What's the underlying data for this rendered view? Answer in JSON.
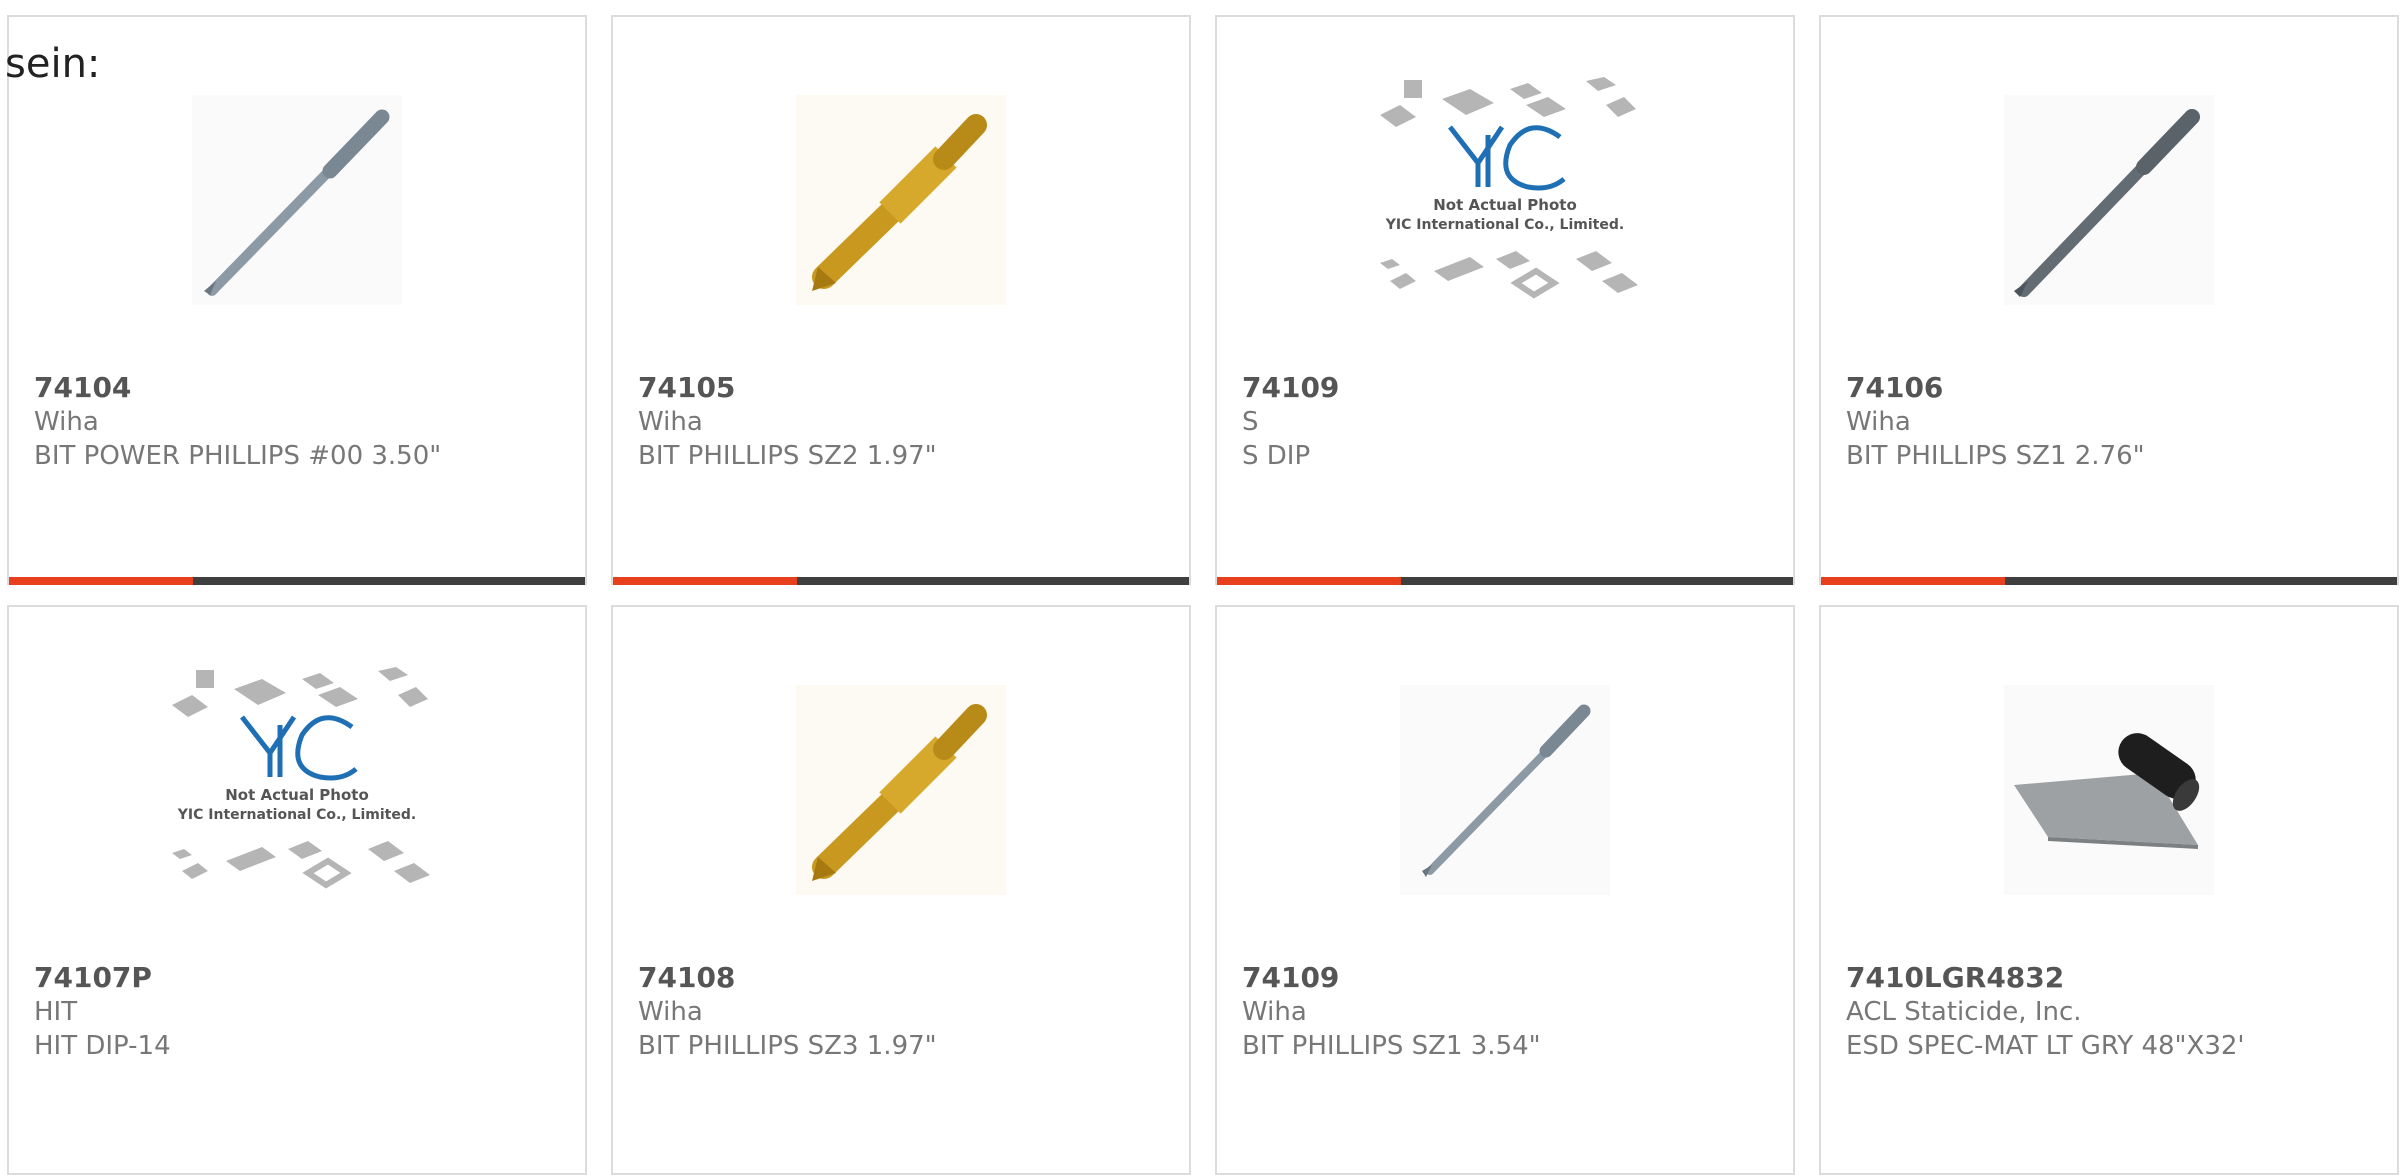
{
  "page": {
    "heading_fragment": "sein:"
  },
  "colors": {
    "accent": "#e8401c",
    "track": "#3f3f3f",
    "text": "#777777",
    "part": "#555555"
  },
  "products": [
    {
      "part_number": "74104",
      "manufacturer": "Wiha",
      "description": "BIT POWER PHILLIPS #00 3.50\"",
      "image": "gray-bit-icon",
      "progress": 0.32
    },
    {
      "part_number": "74105",
      "manufacturer": "Wiha",
      "description": "BIT PHILLIPS SZ2 1.97\"",
      "image": "gold-bit-icon",
      "progress": 0.32
    },
    {
      "part_number": "74109",
      "manufacturer": "S",
      "description": "S DIP",
      "image": "yic-placeholder-icon",
      "progress": 0.32,
      "placeholder": {
        "line1": "Not Actual Photo",
        "line2": "YIC International Co., Limited."
      }
    },
    {
      "part_number": "74106",
      "manufacturer": "Wiha",
      "description": "BIT PHILLIPS SZ1 2.76\"",
      "image": "dark-bit-icon",
      "progress": 0.32
    },
    {
      "part_number": "74107P",
      "manufacturer": "HIT",
      "description": "HIT DIP-14",
      "image": "yic-placeholder-icon",
      "placeholder": {
        "line1": "Not Actual Photo",
        "line2": "YIC International Co., Limited."
      }
    },
    {
      "part_number": "74108",
      "manufacturer": "Wiha",
      "description": "BIT PHILLIPS SZ3 1.97\"",
      "image": "gold-bit-icon"
    },
    {
      "part_number": "74109",
      "manufacturer": "Wiha",
      "description": "BIT PHILLIPS SZ1 3.54\"",
      "image": "gray-bit-icon"
    },
    {
      "part_number": "7410LGR4832",
      "manufacturer": "ACL Staticide, Inc.",
      "description": "ESD SPEC-MAT LT GRY 48\"X32'",
      "image": "esd-mat-icon"
    }
  ]
}
